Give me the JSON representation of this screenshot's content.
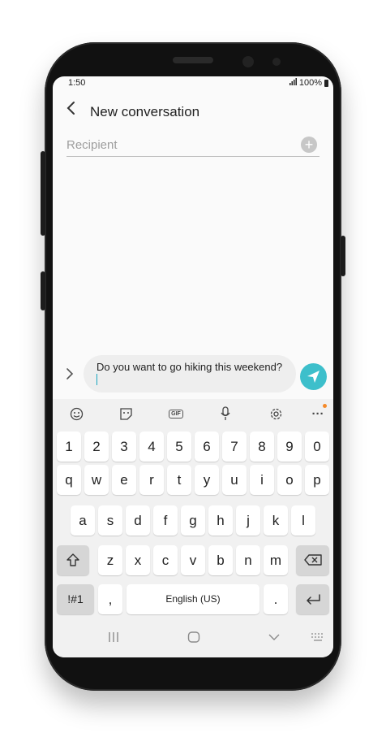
{
  "status_bar": {
    "time": "1:50",
    "battery": "100%"
  },
  "header": {
    "title": "New conversation"
  },
  "recipient": {
    "placeholder": "Recipient"
  },
  "composer": {
    "text": "Do you want to go hiking this weekend?"
  },
  "keyboard": {
    "number_row": [
      "1",
      "2",
      "3",
      "4",
      "5",
      "6",
      "7",
      "8",
      "9",
      "0"
    ],
    "row1": [
      "q",
      "w",
      "e",
      "r",
      "t",
      "y",
      "u",
      "i",
      "o",
      "p"
    ],
    "row2": [
      "a",
      "s",
      "d",
      "f",
      "g",
      "h",
      "j",
      "k",
      "l"
    ],
    "row3": [
      "z",
      "x",
      "c",
      "v",
      "b",
      "n",
      "m"
    ],
    "symbols_label": "!#1",
    "comma_label": ",",
    "space_label": "English (US)",
    "period_label": ".",
    "toolbar": {
      "gif_label": "GIF",
      "more_label": "···"
    }
  },
  "icons": {
    "back": "back-arrow-icon",
    "add": "add-contact-icon",
    "send": "send-icon",
    "emoji": "emoji-icon",
    "sticker": "sticker-icon",
    "gif": "gif-icon",
    "mic": "microphone-icon",
    "settings": "gear-icon",
    "more": "more-icon",
    "shift": "shift-icon",
    "backspace": "backspace-icon",
    "enter": "enter-icon"
  },
  "colors": {
    "send_button": "#3dbfcb",
    "notification_dot": "#f58a2a",
    "cursor": "#1aa5c0"
  }
}
